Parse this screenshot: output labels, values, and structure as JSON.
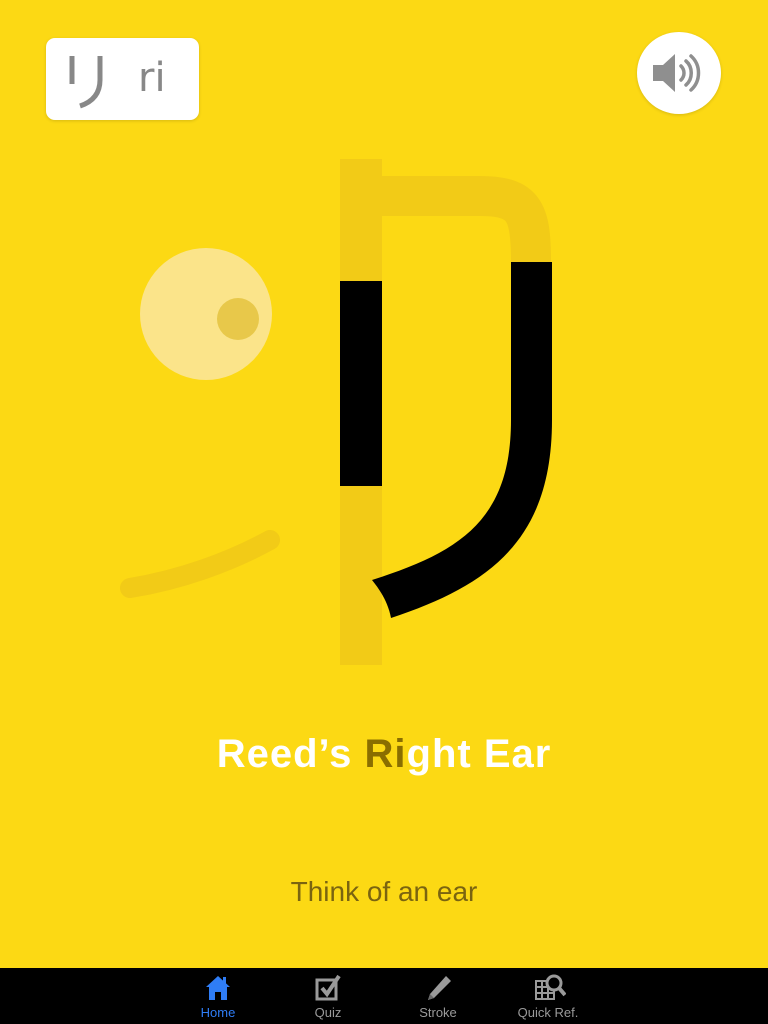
{
  "kana_card": {
    "kana": "り",
    "romaji": "ri"
  },
  "sound_button": {
    "icon": "speaker-icon"
  },
  "mnemonic": {
    "before": "Reed’s ",
    "highlight_r": "R",
    "highlight_i": "i",
    "after": "ght Ear"
  },
  "hint": "Think of an ear",
  "tabs": [
    {
      "label": "Home",
      "icon": "home-icon",
      "active": true
    },
    {
      "label": "Quiz",
      "icon": "checkbox-icon",
      "active": false
    },
    {
      "label": "Stroke",
      "icon": "pencil-icon",
      "active": false
    },
    {
      "label": "Quick Ref.",
      "icon": "grid-magnifier-icon",
      "active": false
    }
  ],
  "colors": {
    "background": "#FCD914",
    "active_tab": "#2F7DF6",
    "highlight": "#8A6E00"
  }
}
